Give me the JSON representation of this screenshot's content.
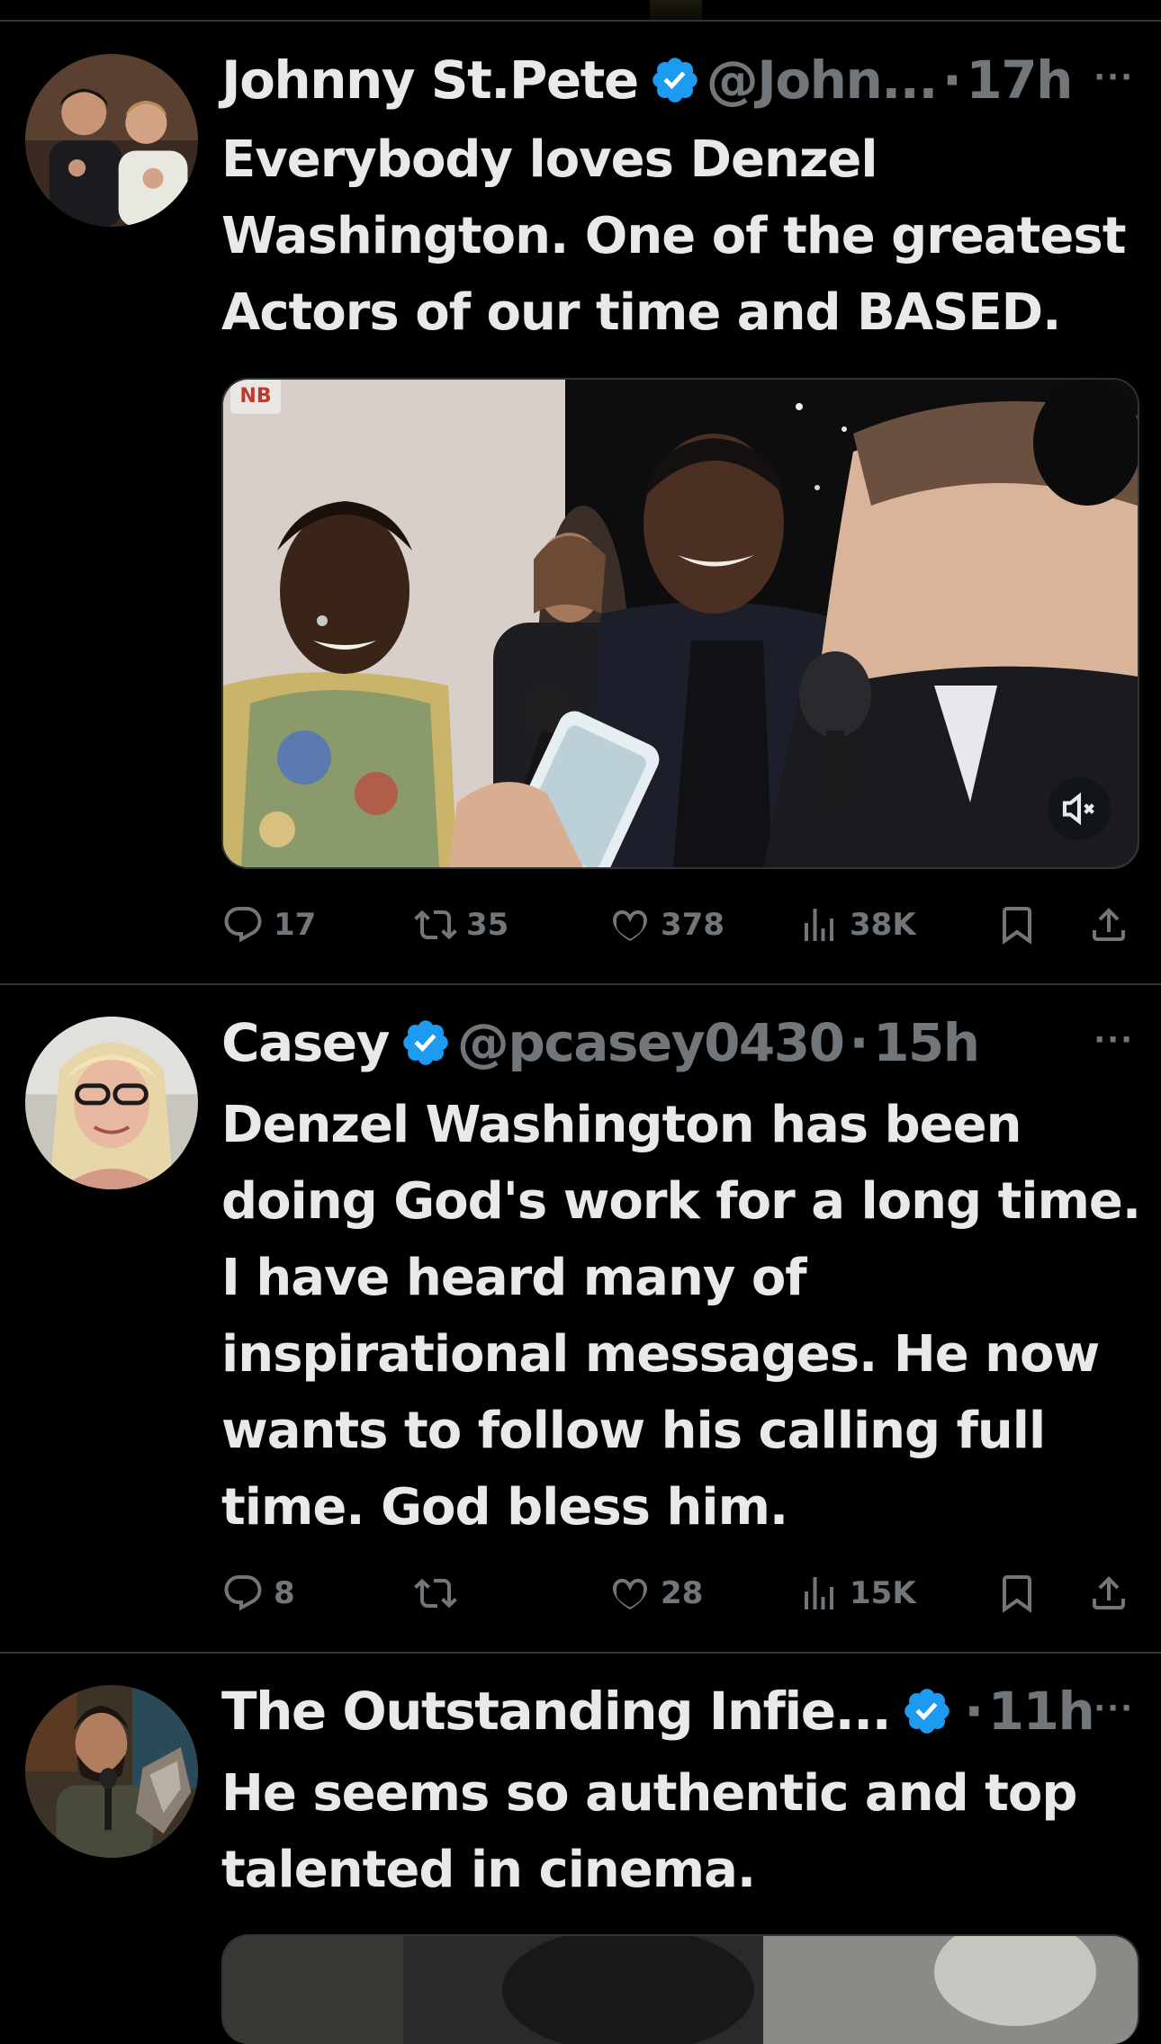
{
  "tweets": [
    {
      "name": "Johnny St.Pete",
      "handle": "@John...",
      "dot": "·",
      "time": "17h",
      "more": "···",
      "text": [
        "Everybody loves Denzel",
        "Washington. One of the greatest",
        "Actors of our time and BASED."
      ],
      "media": {
        "badge": "NB"
      },
      "actions": {
        "replies": "17",
        "reposts": "35",
        "likes": "378",
        "views": "38K"
      }
    },
    {
      "name": "Casey",
      "handle": "@pcasey0430",
      "dot": "·",
      "time": "15h",
      "more": "···",
      "text": [
        "Denzel Washington has been",
        "doing God's work for a long time.",
        "I have heard many of",
        "inspirational messages.  He now",
        "wants to follow his calling full",
        "time.  God bless him."
      ],
      "actions": {
        "replies": "8",
        "reposts": "",
        "likes": "28",
        "views": "15K"
      }
    },
    {
      "name": "The Outstanding Infie...",
      "handle": "",
      "dot": "·",
      "time": "11h",
      "more": "···",
      "text": [
        "He seems so authentic and top",
        "talented in cinema."
      ]
    }
  ],
  "colors": {
    "background": "#000000",
    "text_primary": "#e7e9ea",
    "text_secondary": "#71767b",
    "verified_blue": "#1d9bf0",
    "divider": "#2f3336"
  },
  "icons": [
    "verified-badge-icon",
    "more-icon",
    "reply-icon",
    "repost-icon",
    "like-icon",
    "views-icon",
    "bookmark-icon",
    "share-icon",
    "mute-icon"
  ]
}
